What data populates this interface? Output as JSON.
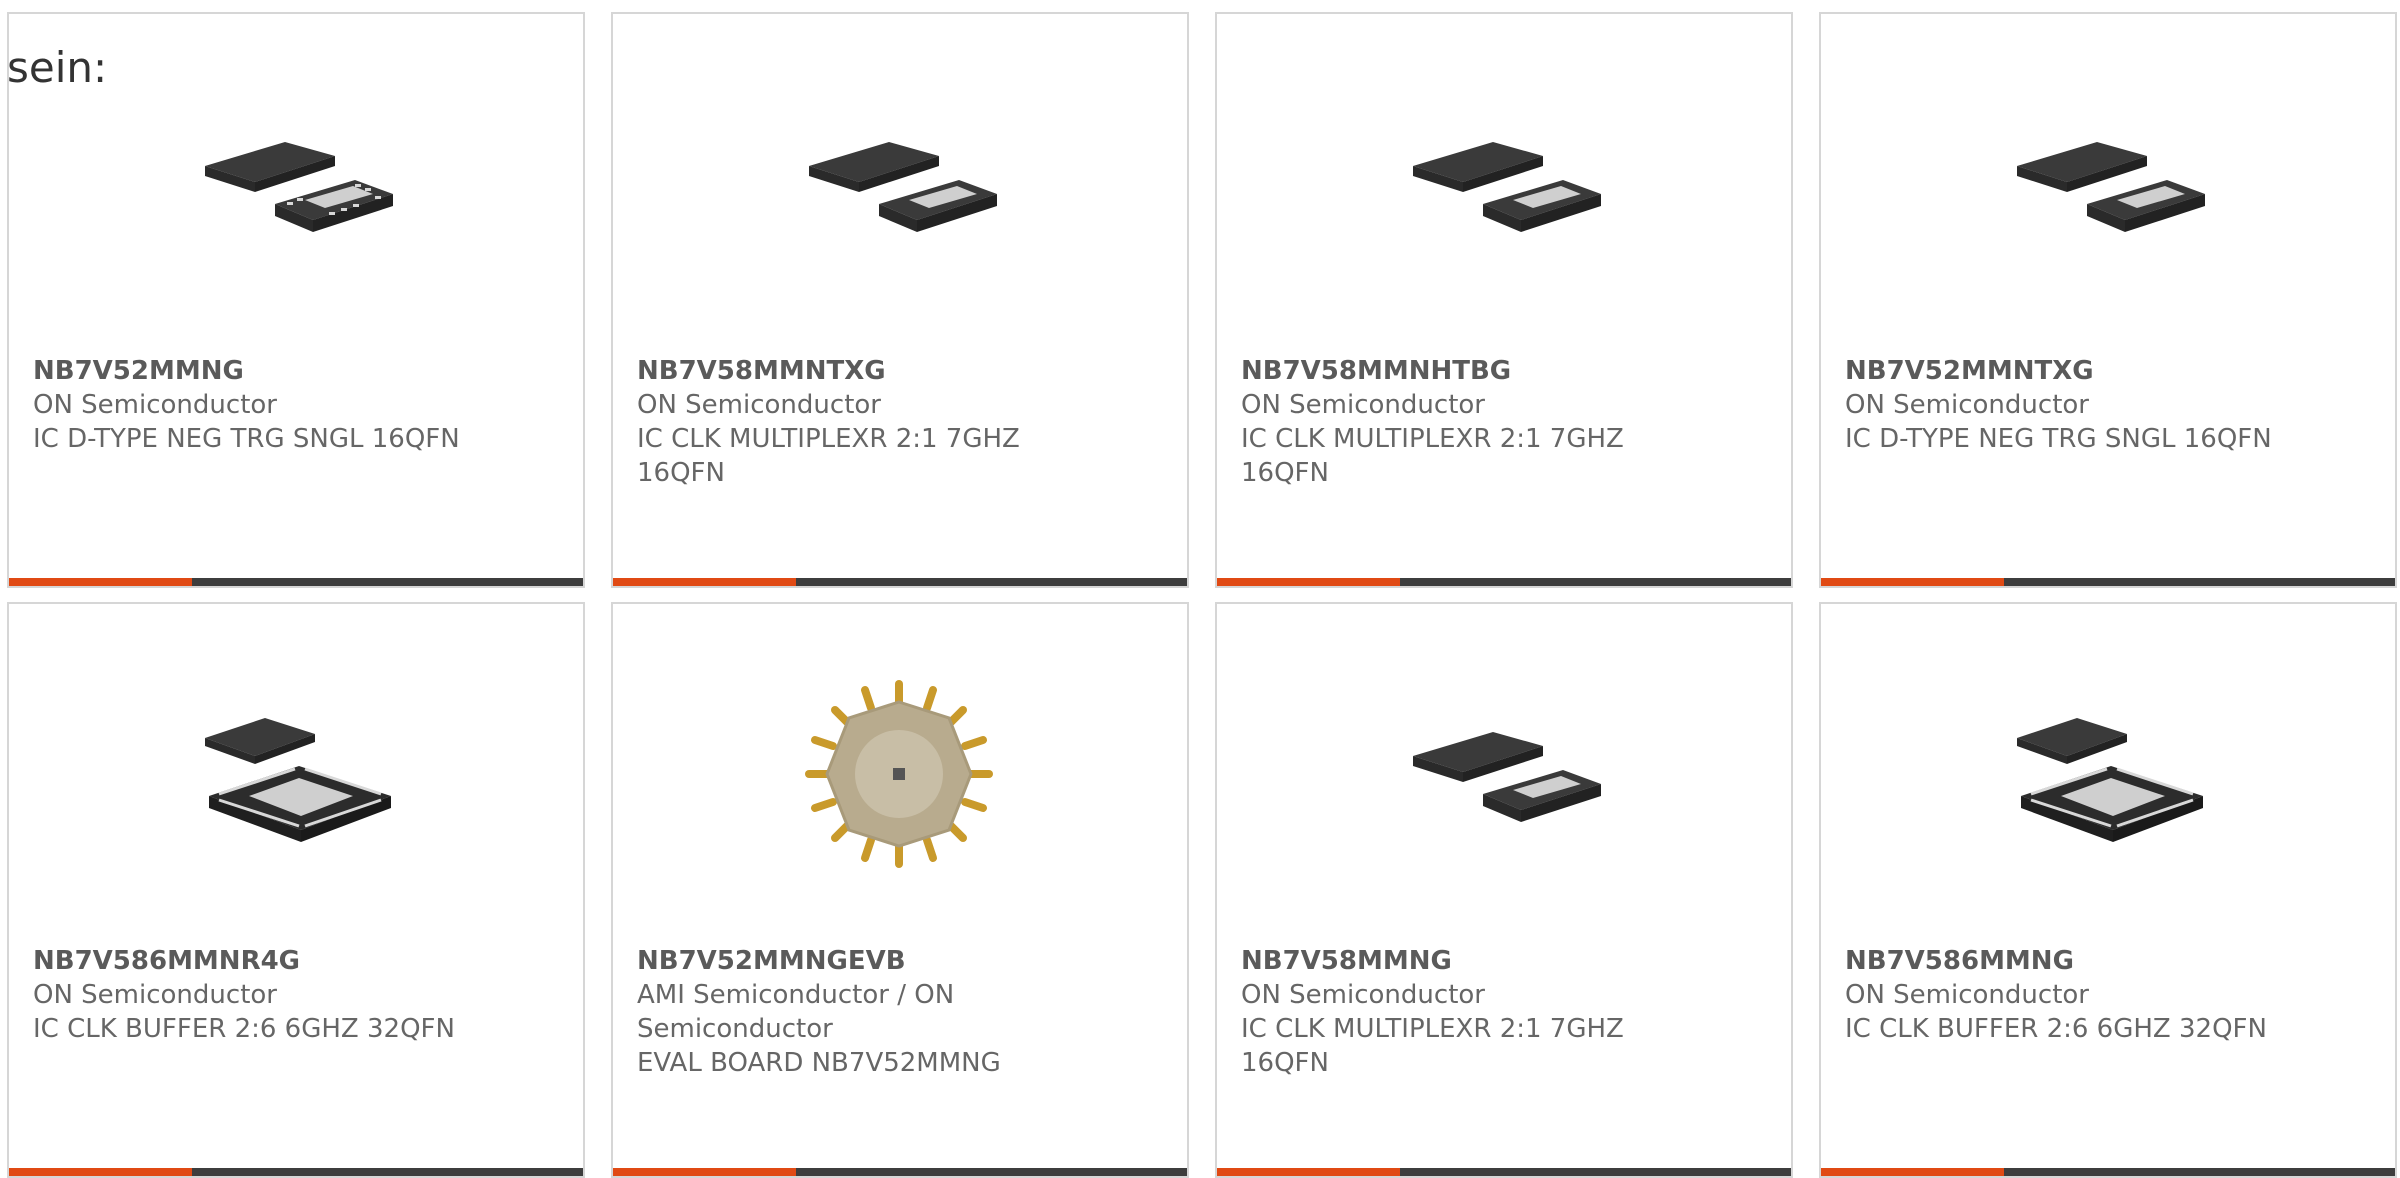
{
  "heading": "sein:",
  "products": [
    {
      "part": "NB7V52MMNG",
      "manufacturer": "ON Semiconductor",
      "description": "IC D-TYPE NEG TRG SNGL 16QFN",
      "image": "qfn16-chip-icon"
    },
    {
      "part": "NB7V58MMNTXG",
      "manufacturer": "ON Semiconductor",
      "description": "IC CLK MULTIPLEXR 2:1 7GHZ 16QFN",
      "image": "qfn16-chip-icon"
    },
    {
      "part": "NB7V58MMNHTBG",
      "manufacturer": "ON Semiconductor",
      "description": "IC CLK MULTIPLEXR 2:1 7GHZ 16QFN",
      "image": "qfn16-chip-icon"
    },
    {
      "part": "NB7V52MMNTXG",
      "manufacturer": "ON Semiconductor",
      "description": "IC D-TYPE NEG TRG SNGL 16QFN",
      "image": "qfn16-chip-icon"
    },
    {
      "part": "NB7V586MMNR4G",
      "manufacturer": "ON Semiconductor",
      "description": "IC CLK BUFFER 2:6 6GHZ 32QFN",
      "image": "qfn32-chip-icon"
    },
    {
      "part": "NB7V52MMNGEVB",
      "manufacturer": "AMI Semiconductor / ON Semiconductor",
      "description": "EVAL BOARD NB7V52MMNG",
      "image": "eval-board-icon"
    },
    {
      "part": "NB7V58MMNG",
      "manufacturer": "ON Semiconductor",
      "description": "IC CLK MULTIPLEXR 2:1 7GHZ 16QFN",
      "image": "qfn16-chip-icon"
    },
    {
      "part": "NB7V586MMNG",
      "manufacturer": "ON Semiconductor",
      "description": "IC CLK BUFFER 2:6 6GHZ 32QFN",
      "image": "qfn32-chip-icon"
    }
  ],
  "colors": {
    "accent": "#e04a14",
    "bar": "#3d3d3d",
    "border": "#d6d6d6",
    "text": "#666666"
  }
}
